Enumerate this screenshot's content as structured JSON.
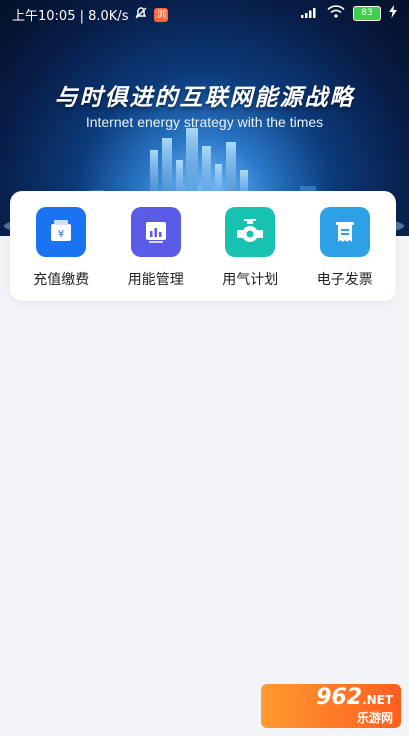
{
  "status_bar": {
    "time_speed": "上午10:05 | 8.0K/s",
    "app_badge": "浏",
    "battery": "83"
  },
  "banner": {
    "title": "与时俱进的互联网能源战略",
    "subtitle": "Internet energy strategy with the times"
  },
  "services": [
    {
      "label": "充值缴费",
      "icon": "yuan-wallet-icon",
      "color": "#1a73f0"
    },
    {
      "label": "用能管理",
      "icon": "chart-icon",
      "color": "#5a5ce8"
    },
    {
      "label": "用气计划",
      "icon": "gas-valve-icon",
      "color": "#18c2b0"
    },
    {
      "label": "电子发票",
      "icon": "invoice-icon",
      "color": "#2ea1e6"
    }
  ],
  "watermark": {
    "number": "962",
    "net": ".NET",
    "site": "乐游网"
  }
}
